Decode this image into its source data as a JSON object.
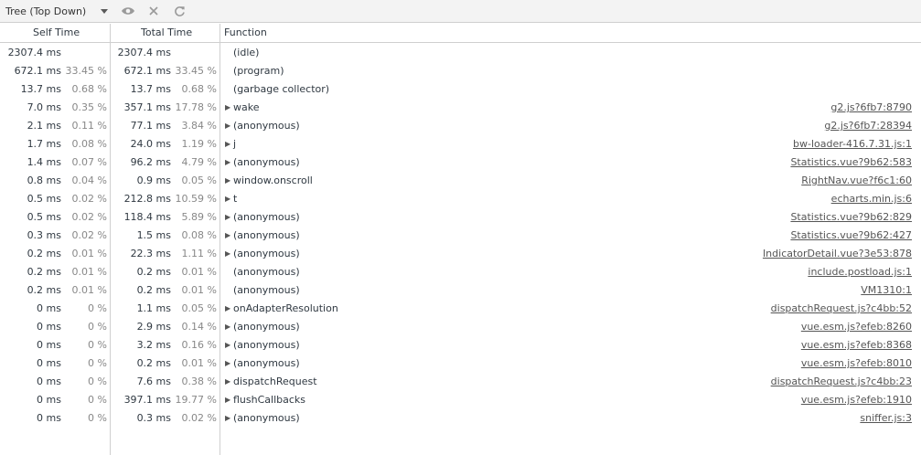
{
  "toolbar": {
    "view_select": "Tree (Top Down)",
    "icons": [
      "chevron-down-icon",
      "eye-icon",
      "close-icon",
      "refresh-icon"
    ]
  },
  "columns": {
    "self_time": "Self Time",
    "total_time": "Total Time",
    "function": "Function"
  },
  "rows": [
    {
      "self": "2307.4 ms",
      "self_pct": "",
      "total": "2307.4 ms",
      "total_pct": "",
      "expandable": false,
      "fn": "(idle)",
      "url": ""
    },
    {
      "self": "672.1 ms",
      "self_pct": "33.45 %",
      "total": "672.1 ms",
      "total_pct": "33.45 %",
      "expandable": false,
      "fn": "(program)",
      "url": ""
    },
    {
      "self": "13.7 ms",
      "self_pct": "0.68 %",
      "total": "13.7 ms",
      "total_pct": "0.68 %",
      "expandable": false,
      "fn": "(garbage collector)",
      "url": ""
    },
    {
      "self": "7.0 ms",
      "self_pct": "0.35 %",
      "total": "357.1 ms",
      "total_pct": "17.78 %",
      "expandable": true,
      "fn": "wake",
      "url": "g2.js?6fb7:8790"
    },
    {
      "self": "2.1 ms",
      "self_pct": "0.11 %",
      "total": "77.1 ms",
      "total_pct": "3.84 %",
      "expandable": true,
      "fn": "(anonymous)",
      "url": "g2.js?6fb7:28394"
    },
    {
      "self": "1.7 ms",
      "self_pct": "0.08 %",
      "total": "24.0 ms",
      "total_pct": "1.19 %",
      "expandable": true,
      "fn": "j",
      "url": "bw-loader-416.7.31.js:1"
    },
    {
      "self": "1.4 ms",
      "self_pct": "0.07 %",
      "total": "96.2 ms",
      "total_pct": "4.79 %",
      "expandable": true,
      "fn": "(anonymous)",
      "url": "Statistics.vue?9b62:583"
    },
    {
      "self": "0.8 ms",
      "self_pct": "0.04 %",
      "total": "0.9 ms",
      "total_pct": "0.05 %",
      "expandable": true,
      "fn": "window.onscroll",
      "url": "RightNav.vue?f6c1:60"
    },
    {
      "self": "0.5 ms",
      "self_pct": "0.02 %",
      "total": "212.8 ms",
      "total_pct": "10.59 %",
      "expandable": true,
      "fn": "t",
      "url": "echarts.min.js:6"
    },
    {
      "self": "0.5 ms",
      "self_pct": "0.02 %",
      "total": "118.4 ms",
      "total_pct": "5.89 %",
      "expandable": true,
      "fn": "(anonymous)",
      "url": "Statistics.vue?9b62:829"
    },
    {
      "self": "0.3 ms",
      "self_pct": "0.02 %",
      "total": "1.5 ms",
      "total_pct": "0.08 %",
      "expandable": true,
      "fn": "(anonymous)",
      "url": "Statistics.vue?9b62:427"
    },
    {
      "self": "0.2 ms",
      "self_pct": "0.01 %",
      "total": "22.3 ms",
      "total_pct": "1.11 %",
      "expandable": true,
      "fn": "(anonymous)",
      "url": "IndicatorDetail.vue?3e53:878"
    },
    {
      "self": "0.2 ms",
      "self_pct": "0.01 %",
      "total": "0.2 ms",
      "total_pct": "0.01 %",
      "expandable": false,
      "fn": "(anonymous)",
      "url": "include.postload.js:1"
    },
    {
      "self": "0.2 ms",
      "self_pct": "0.01 %",
      "total": "0.2 ms",
      "total_pct": "0.01 %",
      "expandable": false,
      "fn": "(anonymous)",
      "url": "VM1310:1"
    },
    {
      "self": "0 ms",
      "self_pct": "0 %",
      "total": "1.1 ms",
      "total_pct": "0.05 %",
      "expandable": true,
      "fn": "onAdapterResolution",
      "url": "dispatchRequest.js?c4bb:52"
    },
    {
      "self": "0 ms",
      "self_pct": "0 %",
      "total": "2.9 ms",
      "total_pct": "0.14 %",
      "expandable": true,
      "fn": "(anonymous)",
      "url": "vue.esm.js?efeb:8260"
    },
    {
      "self": "0 ms",
      "self_pct": "0 %",
      "total": "3.2 ms",
      "total_pct": "0.16 %",
      "expandable": true,
      "fn": "(anonymous)",
      "url": "vue.esm.js?efeb:8368"
    },
    {
      "self": "0 ms",
      "self_pct": "0 %",
      "total": "0.2 ms",
      "total_pct": "0.01 %",
      "expandable": true,
      "fn": "(anonymous)",
      "url": "vue.esm.js?efeb:8010"
    },
    {
      "self": "0 ms",
      "self_pct": "0 %",
      "total": "7.6 ms",
      "total_pct": "0.38 %",
      "expandable": true,
      "fn": "dispatchRequest",
      "url": "dispatchRequest.js?c4bb:23"
    },
    {
      "self": "0 ms",
      "self_pct": "0 %",
      "total": "397.1 ms",
      "total_pct": "19.77 %",
      "expandable": true,
      "fn": "flushCallbacks",
      "url": "vue.esm.js?efeb:1910"
    },
    {
      "self": "0 ms",
      "self_pct": "0 %",
      "total": "0.3 ms",
      "total_pct": "0.02 %",
      "expandable": true,
      "fn": "(anonymous)",
      "url": "sniffer.js:3"
    }
  ]
}
